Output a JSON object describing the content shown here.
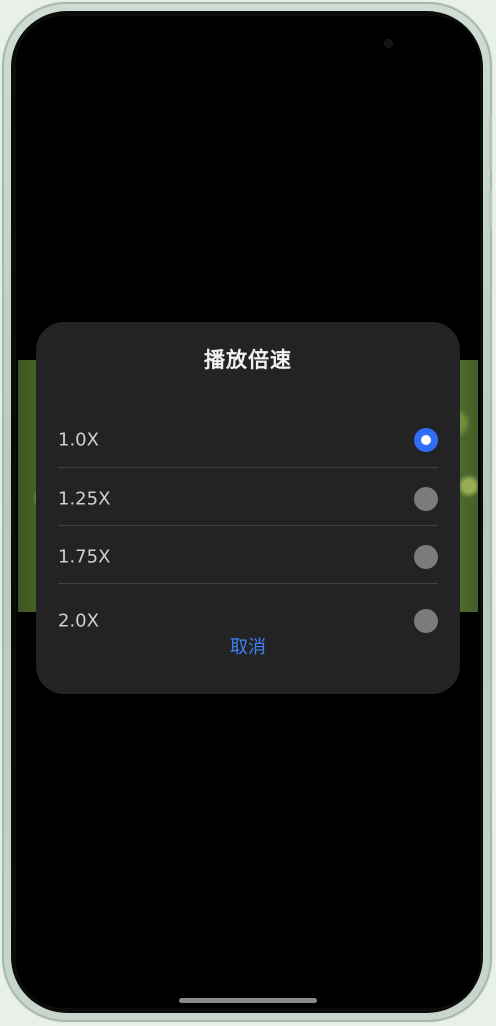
{
  "dialog": {
    "title": "播放倍速",
    "options": [
      {
        "label": "1.0X",
        "selected": true
      },
      {
        "label": "1.25X",
        "selected": false
      },
      {
        "label": "1.75X",
        "selected": false
      },
      {
        "label": "2.0X",
        "selected": false
      }
    ],
    "cancel_label": "取消"
  },
  "colors": {
    "accent": "#2f6df5",
    "dialog_bg": "#232325",
    "cancel_text": "#3e80f5"
  }
}
